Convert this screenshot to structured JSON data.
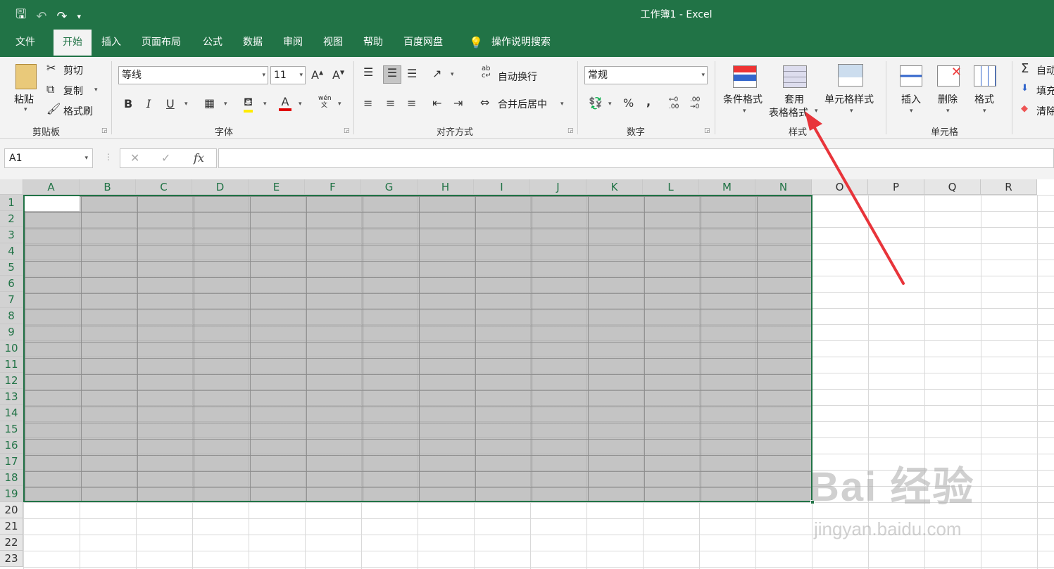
{
  "window": {
    "title": "工作簿1  -  Excel"
  },
  "tabs": [
    {
      "label": "文件"
    },
    {
      "label": "开始"
    },
    {
      "label": "插入"
    },
    {
      "label": "页面布局"
    },
    {
      "label": "公式"
    },
    {
      "label": "数据"
    },
    {
      "label": "审阅"
    },
    {
      "label": "视图"
    },
    {
      "label": "帮助"
    },
    {
      "label": "百度网盘"
    }
  ],
  "tell_me": "操作说明搜索",
  "ribbon": {
    "clipboard": {
      "label": "剪贴板",
      "paste": "粘贴",
      "cut": "剪切",
      "copy": "复制",
      "format_painter": "格式刷"
    },
    "font": {
      "label": "字体",
      "font_name": "等线",
      "font_size": "11",
      "bold": "B",
      "italic": "I",
      "underline": "U",
      "wen": "wén",
      "wen2": "文"
    },
    "alignment": {
      "label": "对齐方式",
      "wrap_text": "自动换行",
      "merge_center": "合并后居中",
      "ab": "ab",
      "c": "c"
    },
    "number": {
      "label": "数字",
      "format": "常规",
      "percent": "%",
      "comma": ",",
      "inc": "←0\n.00",
      "dec": ".00\n→0"
    },
    "styles": {
      "label": "样式",
      "conditional": "条件格式",
      "table_format_1": "套用",
      "table_format_2": "表格格式",
      "cell_styles": "单元格样式"
    },
    "cells": {
      "label": "单元格",
      "insert": "插入",
      "delete": "删除",
      "format": "格式"
    },
    "editing": {
      "autosum": "自动",
      "fill": "填充",
      "clear": "清除"
    }
  },
  "formula_bar": {
    "name_box": "A1",
    "fx": "fx"
  },
  "columns": [
    "A",
    "B",
    "C",
    "D",
    "E",
    "F",
    "G",
    "H",
    "I",
    "J",
    "K",
    "L",
    "M",
    "N",
    "O",
    "P",
    "Q",
    "R"
  ],
  "rows": [
    "1",
    "2",
    "3",
    "4",
    "5",
    "6",
    "7",
    "8",
    "9",
    "10",
    "11",
    "12",
    "13",
    "14",
    "15",
    "16",
    "17",
    "18",
    "19",
    "20",
    "21",
    "22",
    "23"
  ],
  "selection": {
    "range": "A1:N19"
  },
  "watermark": {
    "brand": "Bai  经验",
    "url": "jingyan.baidu.com"
  },
  "colors": {
    "accent": "#217346",
    "annotation": "#e8343a"
  }
}
